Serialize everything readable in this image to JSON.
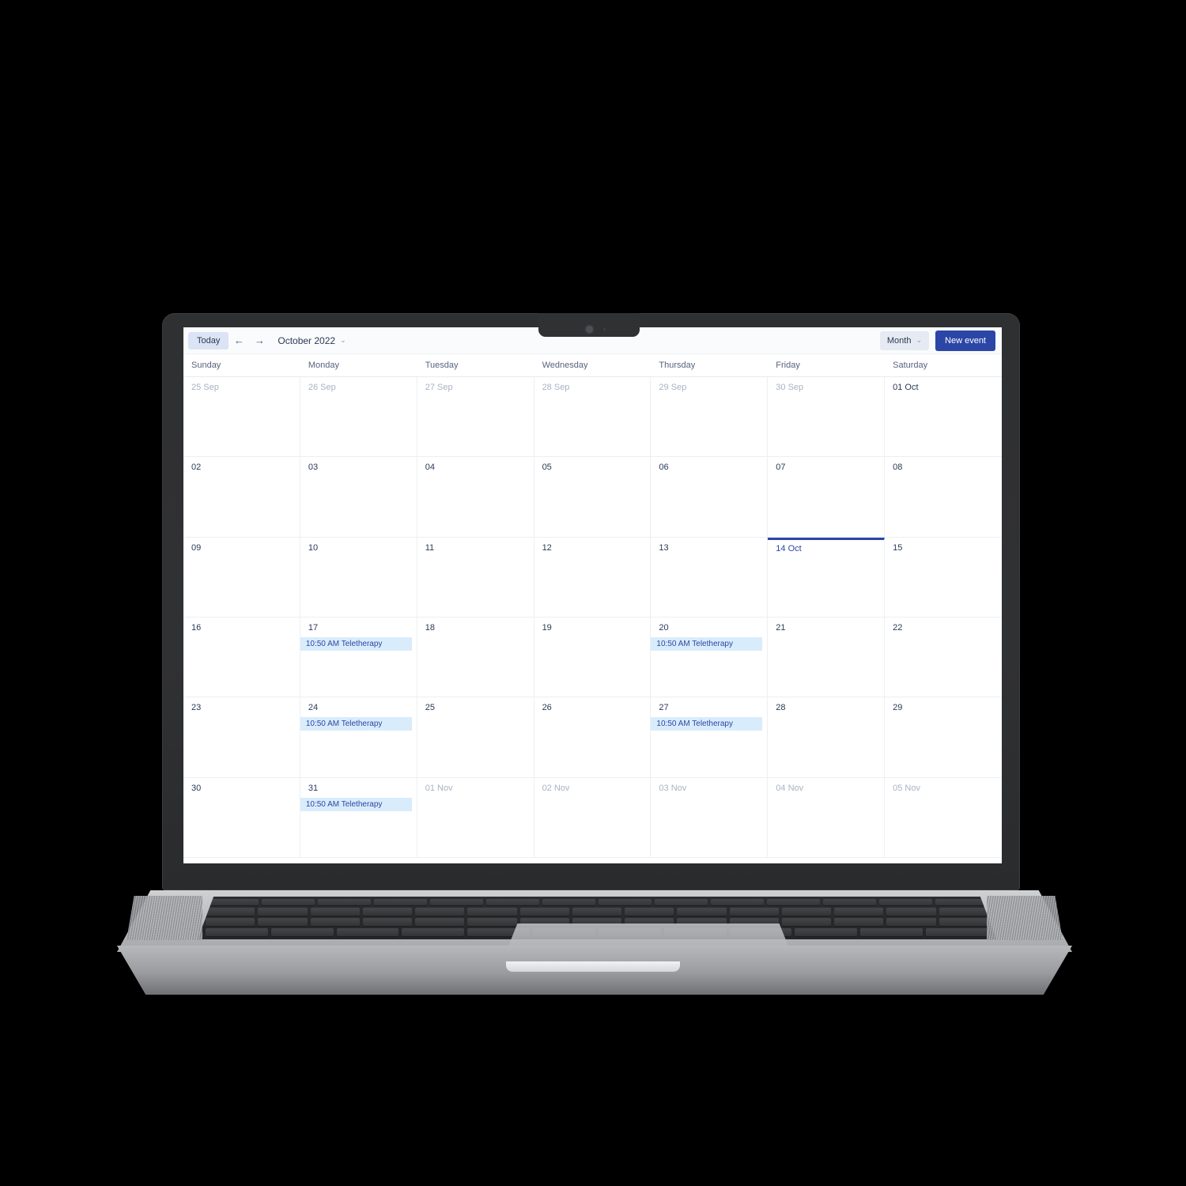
{
  "toolbar": {
    "today_label": "Today",
    "prev_icon": "arrow-left-icon",
    "next_icon": "arrow-right-icon",
    "month_label": "October 2022",
    "month_caret": "⌄",
    "view_label": "Month",
    "view_caret": "⌄",
    "new_event_label": "New event"
  },
  "weekdays": [
    "Sunday",
    "Monday",
    "Tuesday",
    "Wednesday",
    "Thursday",
    "Friday",
    "Saturday"
  ],
  "colors": {
    "accent": "#2b46a6",
    "today_bar": "#2b46a6",
    "event_bg": "#d9ecfb",
    "event_text": "#2b46a6",
    "muted_day": "#a9b2c3",
    "day_text": "#2b3a55",
    "toolbar_bg": "#fafbfc",
    "today_btn_bg": "#dbe3f5"
  },
  "event_title": "Teletherapy",
  "event_time": "10:50 AM",
  "cells": [
    {
      "label": "25 Sep",
      "other": true,
      "today": false,
      "events": []
    },
    {
      "label": "26 Sep",
      "other": true,
      "today": false,
      "events": []
    },
    {
      "label": "27 Sep",
      "other": true,
      "today": false,
      "events": []
    },
    {
      "label": "28 Sep",
      "other": true,
      "today": false,
      "events": []
    },
    {
      "label": "29 Sep",
      "other": true,
      "today": false,
      "events": []
    },
    {
      "label": "30 Sep",
      "other": true,
      "today": false,
      "events": []
    },
    {
      "label": "01 Oct",
      "other": false,
      "today": false,
      "events": []
    },
    {
      "label": "02",
      "other": false,
      "today": false,
      "events": []
    },
    {
      "label": "03",
      "other": false,
      "today": false,
      "events": []
    },
    {
      "label": "04",
      "other": false,
      "today": false,
      "events": []
    },
    {
      "label": "05",
      "other": false,
      "today": false,
      "events": []
    },
    {
      "label": "06",
      "other": false,
      "today": false,
      "events": []
    },
    {
      "label": "07",
      "other": false,
      "today": false,
      "events": []
    },
    {
      "label": "08",
      "other": false,
      "today": false,
      "events": []
    },
    {
      "label": "09",
      "other": false,
      "today": false,
      "events": []
    },
    {
      "label": "10",
      "other": false,
      "today": false,
      "events": []
    },
    {
      "label": "11",
      "other": false,
      "today": false,
      "events": []
    },
    {
      "label": "12",
      "other": false,
      "today": false,
      "events": []
    },
    {
      "label": "13",
      "other": false,
      "today": false,
      "events": []
    },
    {
      "label": "14 Oct",
      "other": false,
      "today": true,
      "events": []
    },
    {
      "label": "15",
      "other": false,
      "today": false,
      "events": []
    },
    {
      "label": "16",
      "other": false,
      "today": false,
      "events": []
    },
    {
      "label": "17",
      "other": false,
      "today": false,
      "events": [
        "10:50 AM Teletherapy"
      ]
    },
    {
      "label": "18",
      "other": false,
      "today": false,
      "events": []
    },
    {
      "label": "19",
      "other": false,
      "today": false,
      "events": []
    },
    {
      "label": "20",
      "other": false,
      "today": false,
      "events": [
        "10:50 AM Teletherapy"
      ]
    },
    {
      "label": "21",
      "other": false,
      "today": false,
      "events": []
    },
    {
      "label": "22",
      "other": false,
      "today": false,
      "events": []
    },
    {
      "label": "23",
      "other": false,
      "today": false,
      "events": []
    },
    {
      "label": "24",
      "other": false,
      "today": false,
      "events": [
        "10:50 AM Teletherapy"
      ]
    },
    {
      "label": "25",
      "other": false,
      "today": false,
      "events": []
    },
    {
      "label": "26",
      "other": false,
      "today": false,
      "events": []
    },
    {
      "label": "27",
      "other": false,
      "today": false,
      "events": [
        "10:50 AM Teletherapy"
      ]
    },
    {
      "label": "28",
      "other": false,
      "today": false,
      "events": []
    },
    {
      "label": "29",
      "other": false,
      "today": false,
      "events": []
    },
    {
      "label": "30",
      "other": false,
      "today": false,
      "events": []
    },
    {
      "label": "31",
      "other": false,
      "today": false,
      "events": [
        "10:50 AM Teletherapy"
      ]
    },
    {
      "label": "01 Nov",
      "other": true,
      "today": false,
      "events": []
    },
    {
      "label": "02 Nov",
      "other": true,
      "today": false,
      "events": []
    },
    {
      "label": "03 Nov",
      "other": true,
      "today": false,
      "events": []
    },
    {
      "label": "04 Nov",
      "other": true,
      "today": false,
      "events": []
    },
    {
      "label": "05 Nov",
      "other": true,
      "today": false,
      "events": []
    }
  ]
}
